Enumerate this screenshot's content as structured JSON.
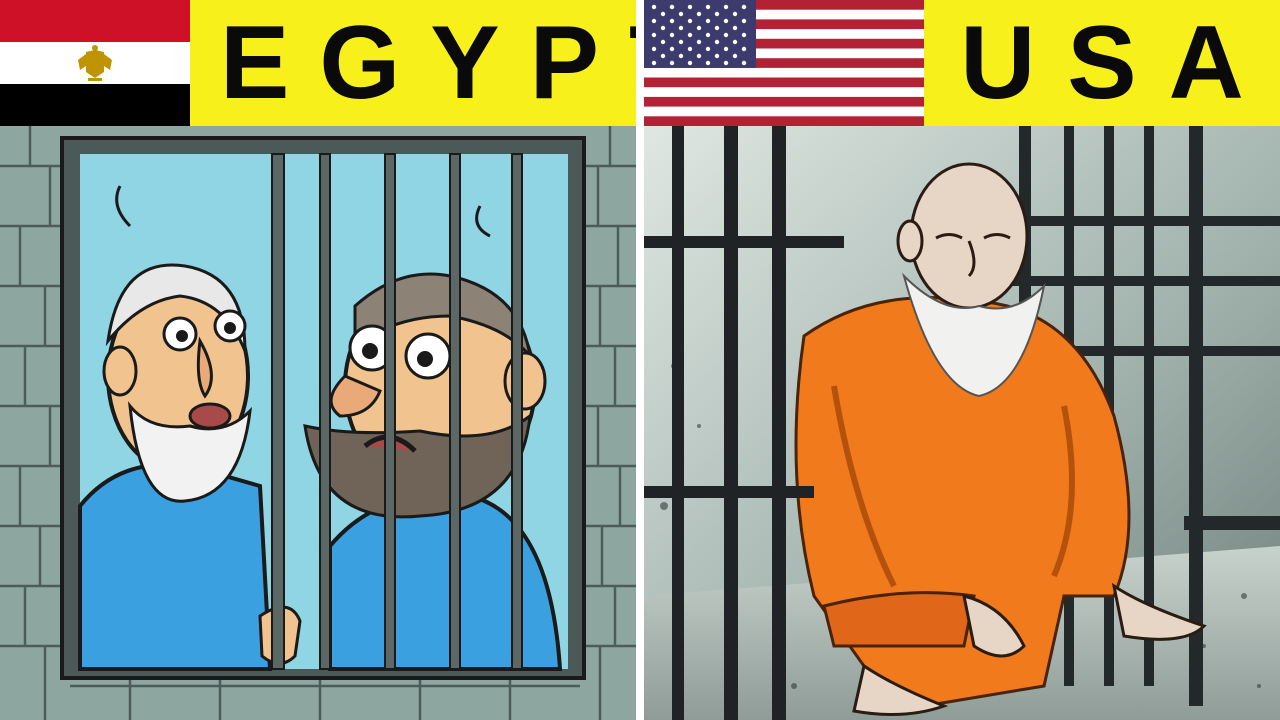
{
  "left_panel": {
    "country_name": "EGYPT",
    "flag": {
      "icon": "egypt-flag-icon",
      "colors": [
        "#ce1126",
        "#ffffff",
        "#000000"
      ],
      "emblem_color": "#c09300"
    },
    "header_background": "#f7f01a",
    "scene": "cartoon-prison-cell"
  },
  "right_panel": {
    "country_name": "USA",
    "flag": {
      "icon": "usa-flag-icon",
      "colors": [
        "#b22234",
        "#ffffff",
        "#3c3b6e"
      ]
    },
    "header_background": "#f7f01a",
    "scene": "realistic-prison-cell"
  },
  "colors": {
    "header_yellow": "#f7f01a",
    "text_black": "#0a0a0a",
    "uniform_blue": "#3aa0e0",
    "uniform_orange": "#f07a1c"
  }
}
